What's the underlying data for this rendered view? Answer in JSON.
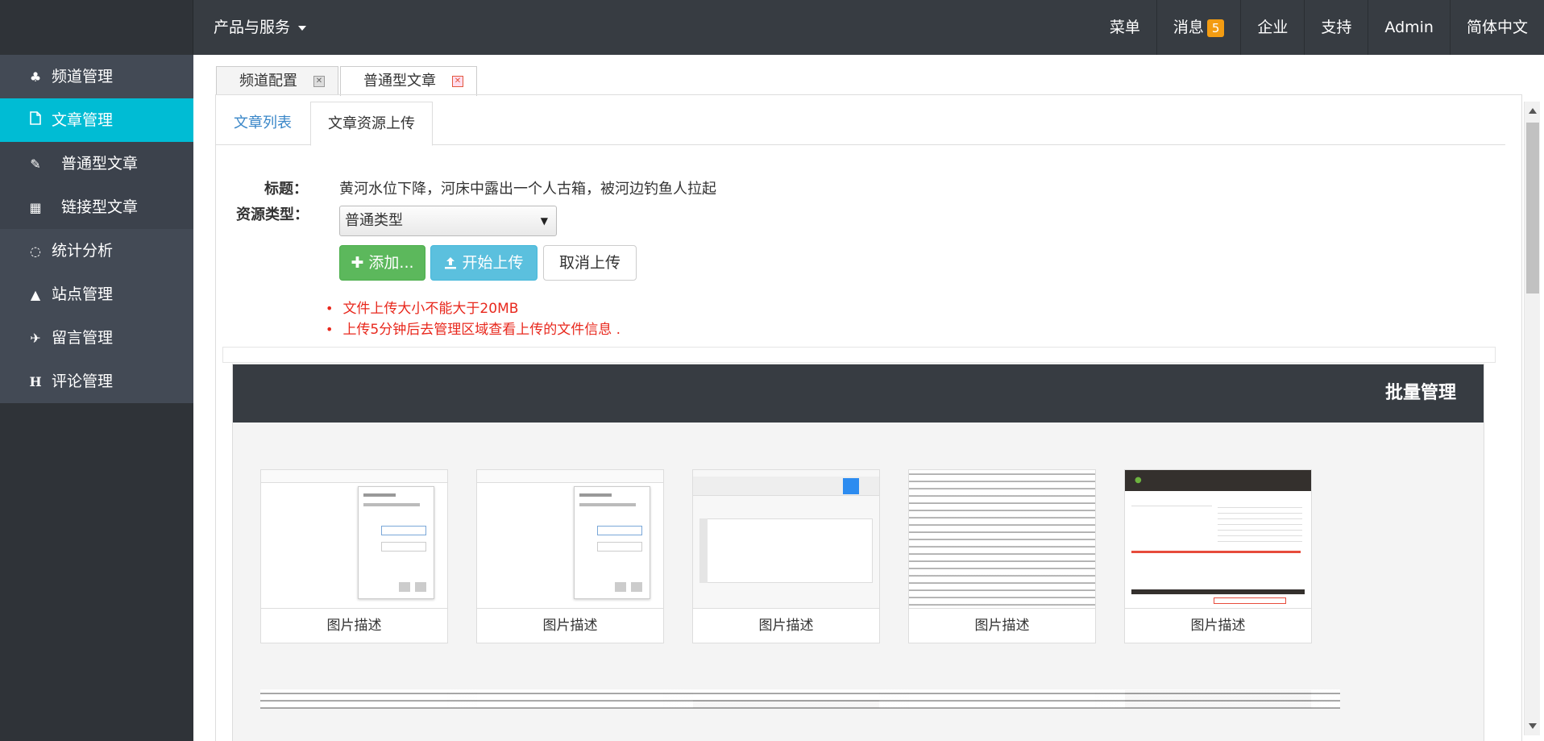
{
  "topbar": {
    "menu_label": "产品与服务",
    "items": [
      {
        "label": "菜单"
      },
      {
        "label": "消息",
        "badge": "5"
      },
      {
        "label": "企业"
      },
      {
        "label": "支持"
      },
      {
        "label": "Admin"
      },
      {
        "label": "简体中文"
      }
    ]
  },
  "sidebar": {
    "items": [
      {
        "label": "频道管理",
        "icon": "tree-icon"
      },
      {
        "label": "文章管理",
        "icon": "file-icon"
      },
      {
        "label": "普通型文章",
        "icon": "edit-icon"
      },
      {
        "label": "链接型文章",
        "icon": "building-icon"
      },
      {
        "label": "统计分析",
        "icon": "circle-notch-icon"
      },
      {
        "label": "站点管理",
        "icon": "graduation-cap-icon"
      },
      {
        "label": "留言管理",
        "icon": "plane-icon"
      },
      {
        "label": "评论管理",
        "icon": "header-icon"
      }
    ]
  },
  "page_tabs": [
    {
      "label": "频道配置"
    },
    {
      "label": "普通型文章"
    }
  ],
  "inner_tabs": {
    "list": "文章列表",
    "upload": "文章资源上传"
  },
  "form": {
    "title_label": "标题：",
    "title_value": "黄河水位下降，河床中露出一个人古箱，被河边钓鱼人拉起",
    "type_label": "资源类型：",
    "type_value": "普通类型",
    "add_button": "添加...",
    "upload_button": "开始上传",
    "cancel_button": "取消上传",
    "notes": [
      "文件上传大小不能大于20MB",
      "上传5分钟后去管理区域查看上传的文件信息 ."
    ]
  },
  "panel": {
    "title": "批量管理",
    "cards": [
      {
        "caption": "图片描述"
      },
      {
        "caption": "图片描述"
      },
      {
        "caption": "图片描述"
      },
      {
        "caption": "图片描述"
      },
      {
        "caption": "图片描述"
      }
    ]
  },
  "colors": {
    "topbar": "#373c42",
    "sidebar": "#2f3338",
    "active": "#00bcd4",
    "success": "#5cb85c",
    "info": "#5bc0de",
    "badge": "#f39c12",
    "danger_text": "#e8281d"
  }
}
